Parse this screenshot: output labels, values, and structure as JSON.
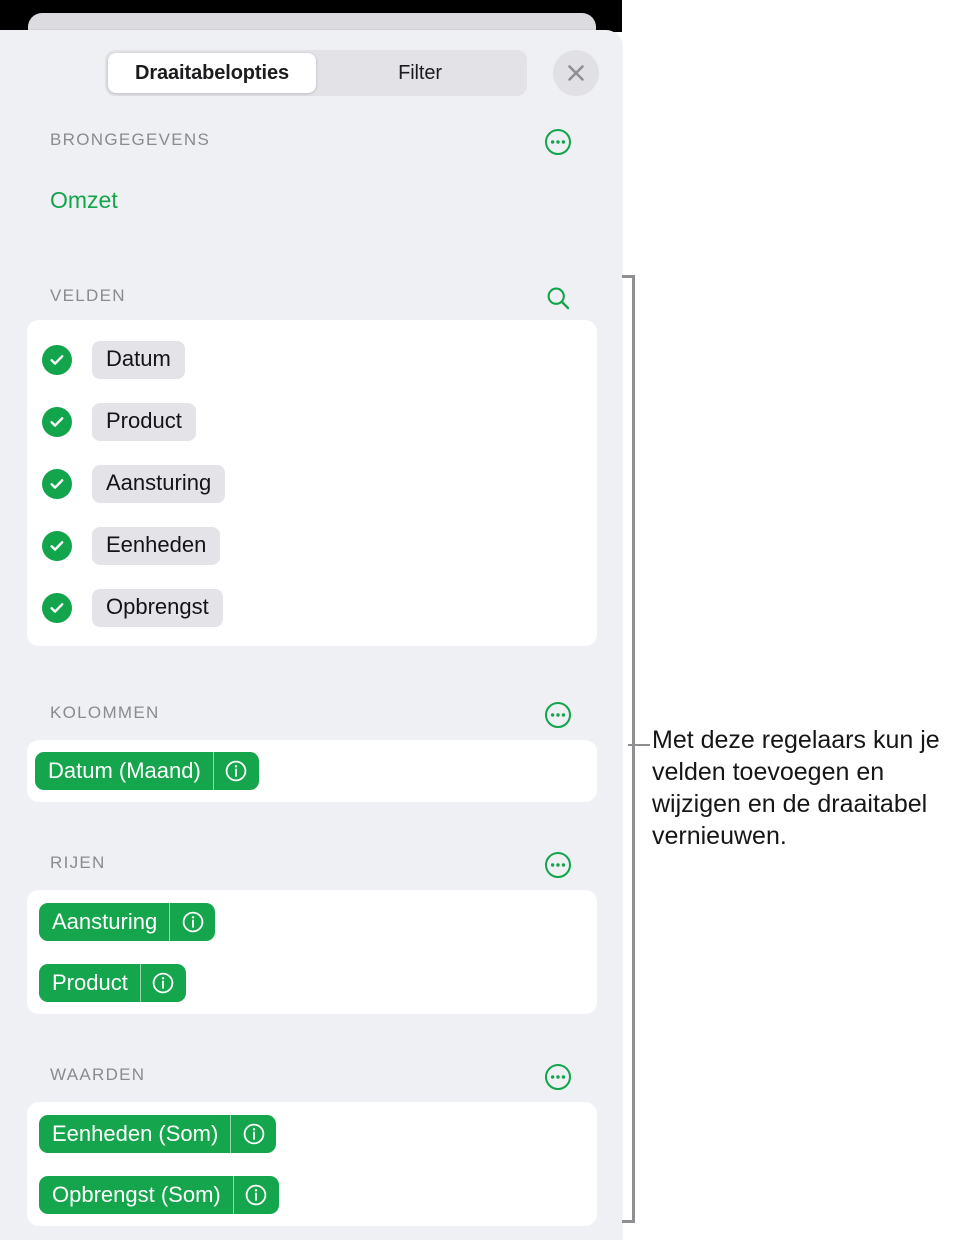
{
  "window": {
    "app_chrome_color": "#000000",
    "panel_background": "#eff0f4",
    "accent_green": "#15a54c"
  },
  "header": {
    "tabs": [
      {
        "label": "Draaitabelopties",
        "selected": true
      },
      {
        "label": "Filter",
        "selected": false
      }
    ],
    "close_icon": "close-icon"
  },
  "sections": {
    "source": {
      "title": "BRONGEGEVENS",
      "action_icon": "more-options-icon",
      "value": "Omzet"
    },
    "fields": {
      "title": "VELDEN",
      "action_icon": "search-icon",
      "items": [
        {
          "label": "Datum",
          "checked": true
        },
        {
          "label": "Product",
          "checked": true
        },
        {
          "label": "Aansturing",
          "checked": true
        },
        {
          "label": "Eenheden",
          "checked": true
        },
        {
          "label": "Opbrengst",
          "checked": true
        }
      ]
    },
    "columns": {
      "title": "KOLOMMEN",
      "action_icon": "more-options-icon",
      "items": [
        {
          "label": "Datum (Maand)",
          "info_icon": "info-icon"
        }
      ]
    },
    "rows": {
      "title": "RIJEN",
      "action_icon": "more-options-icon",
      "items": [
        {
          "label": "Aansturing",
          "info_icon": "info-icon"
        },
        {
          "label": "Product",
          "info_icon": "info-icon"
        }
      ]
    },
    "values": {
      "title": "WAARDEN",
      "action_icon": "more-options-icon",
      "items": [
        {
          "label": "Eenheden (Som)",
          "info_icon": "info-icon"
        },
        {
          "label": "Opbrengst (Som)",
          "info_icon": "info-icon"
        }
      ]
    }
  },
  "annotation": {
    "text": "Met deze regelaars kun je velden toevoegen en wijzigen en de draaitabel vernieuwen.",
    "bracket_color": "#8e8e93"
  }
}
